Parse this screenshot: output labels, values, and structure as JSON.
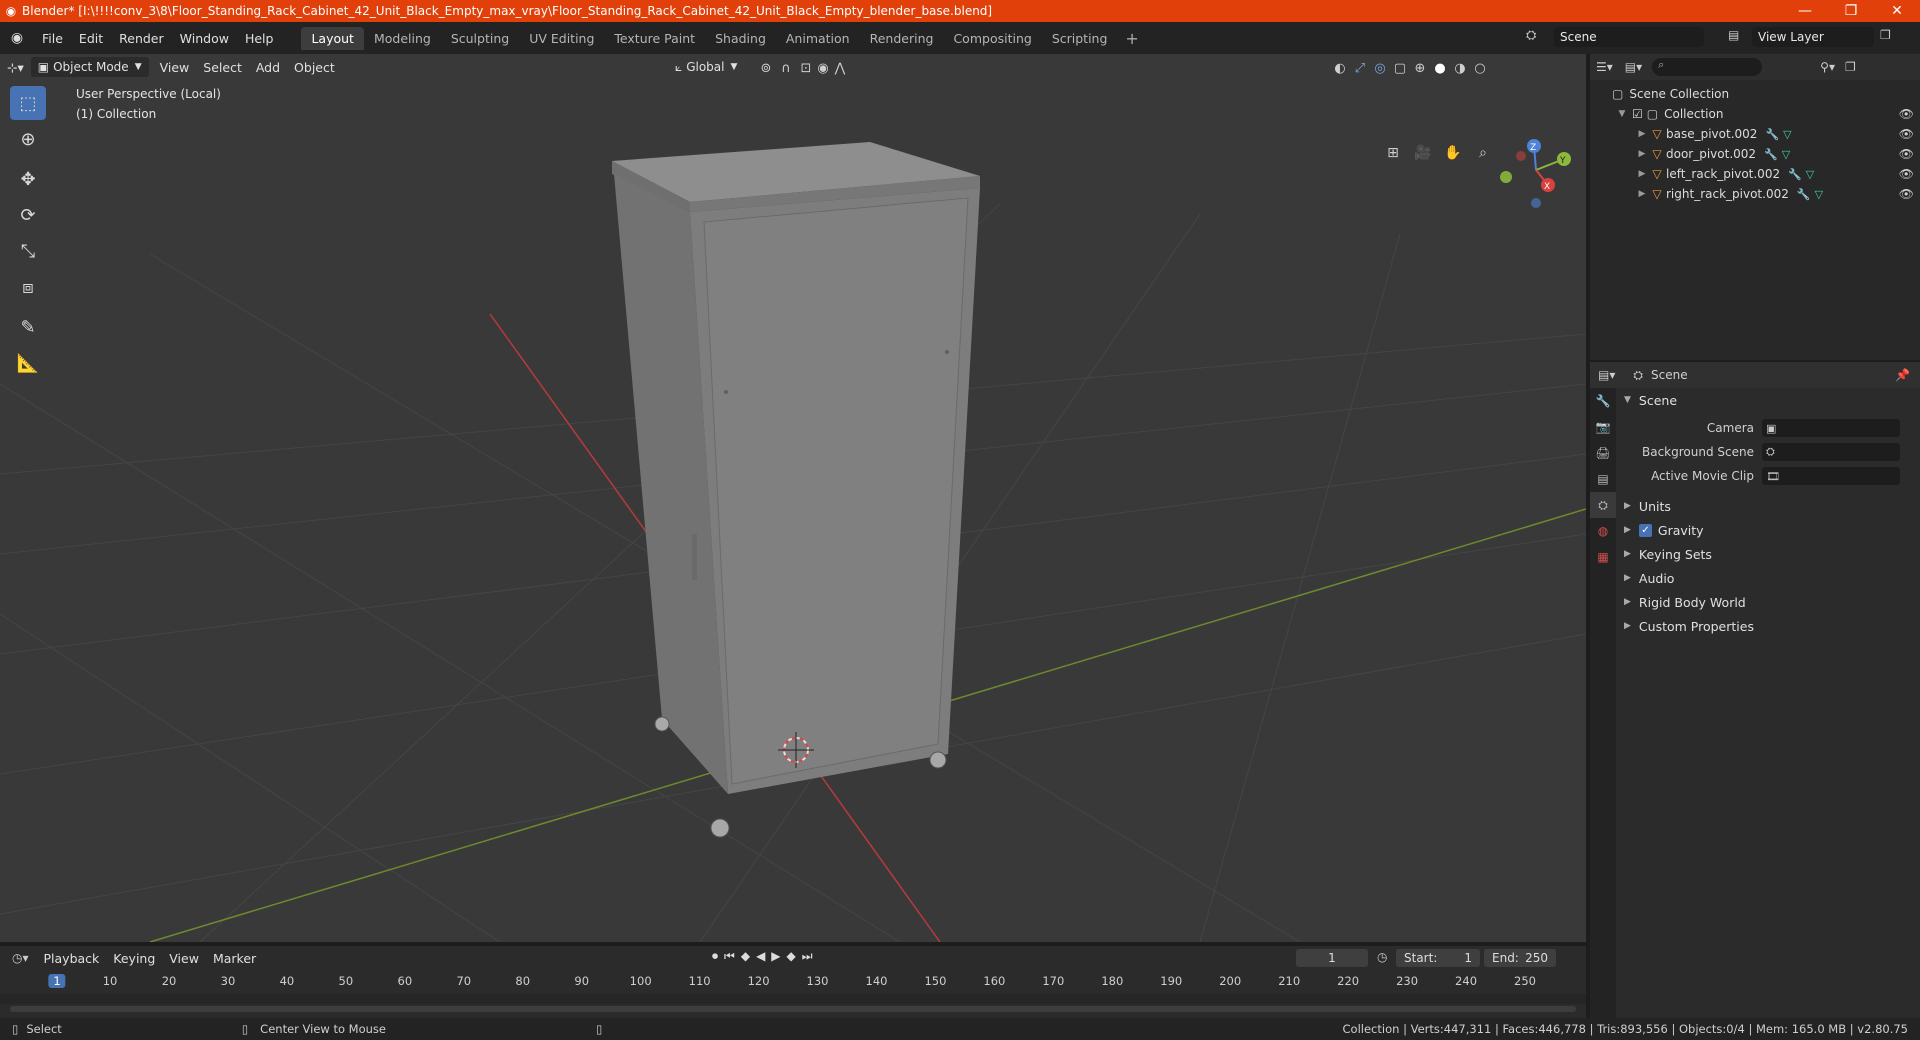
{
  "window": {
    "title": "Blender* [I:\\!!!!conv_3\\8\\Floor_Standing_Rack_Cabinet_42_Unit_Black_Empty_max_vray\\Floor_Standing_Rack_Cabinet_42_Unit_Black_Empty_blender_base.blend]",
    "minimize": "—",
    "restore": "❐",
    "close": "✕"
  },
  "menu": [
    "File",
    "Edit",
    "Render",
    "Window",
    "Help"
  ],
  "workspaces": [
    "Layout",
    "Modeling",
    "Sculpting",
    "UV Editing",
    "Texture Paint",
    "Shading",
    "Animation",
    "Rendering",
    "Compositing",
    "Scripting"
  ],
  "active_workspace": "Layout",
  "scene_field": "Scene",
  "view_layer_field": "View Layer",
  "viewport": {
    "mode": "Object Mode",
    "menus": [
      "View",
      "Select",
      "Add",
      "Object"
    ],
    "transform_orientation": "Global",
    "info_line1": "User Perspective (Local)",
    "info_line2": "(1) Collection",
    "gizmo_axes": [
      "X",
      "Y",
      "Z"
    ]
  },
  "outliner": {
    "root": "Scene Collection",
    "collection": "Collection",
    "objects": [
      "base_pivot.002",
      "door_pivot.002",
      "left_rack_pivot.002",
      "right_rack_pivot.002"
    ]
  },
  "properties": {
    "header": "Scene",
    "panel": "Scene",
    "fields": [
      {
        "label": "Camera",
        "value": ""
      },
      {
        "label": "Background Scene",
        "value": ""
      },
      {
        "label": "Active Movie Clip",
        "value": ""
      }
    ],
    "subpanels": [
      "Units",
      "Gravity",
      "Keying Sets",
      "Audio",
      "Rigid Body World",
      "Custom Properties"
    ],
    "gravity_checked": true
  },
  "timeline": {
    "menus": [
      "Playback",
      "Keying",
      "View",
      "Marker"
    ],
    "current_frame": "1",
    "start_label": "Start:",
    "start": "1",
    "end_label": "End:",
    "end": "250",
    "ticks": [
      "1",
      "10",
      "20",
      "30",
      "40",
      "50",
      "60",
      "70",
      "80",
      "90",
      "100",
      "110",
      "120",
      "130",
      "140",
      "150",
      "160",
      "170",
      "180",
      "190",
      "200",
      "210",
      "220",
      "230",
      "240",
      "250"
    ]
  },
  "statusbar": {
    "select": "Select",
    "center_view": "Center View to Mouse",
    "stats": "Collection | Verts:447,311 | Faces:446,778 | Tris:893,556 | Objects:0/4 | Mem: 165.0 MB | v2.80.75"
  },
  "colors": {
    "titlebar": "#e2400b",
    "viewport_bg": "#393939",
    "accent": "#4772b3",
    "x_axis": "#d9413f",
    "y_axis": "#8cb83c",
    "z_axis": "#4d82d6"
  }
}
